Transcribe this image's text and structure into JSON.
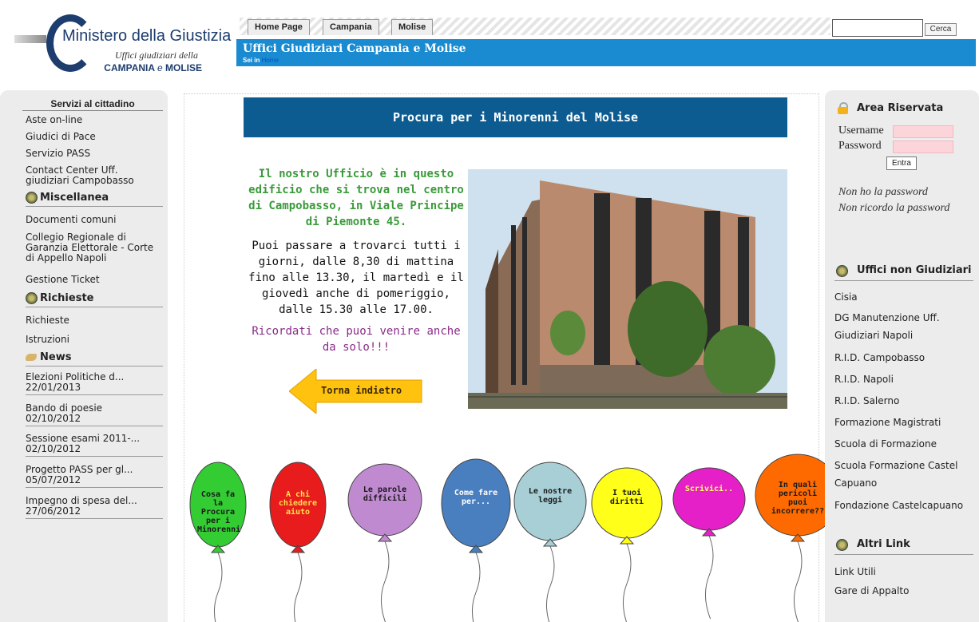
{
  "header": {
    "logo_title_part1": "Ministero della",
    "logo_title_part2": "Giustizia",
    "logo_sub1": "Uffici giudiziari della",
    "logo_sub2_a": "CAMPANIA",
    "logo_sub2_b": "e",
    "logo_sub2_c": "MOLISE",
    "tabs": [
      "Home Page",
      "Campania",
      "Molise"
    ],
    "site_title": "Uffici Giudiziari Campania e Molise",
    "breadcrumb_prefix": "Sei in",
    "breadcrumb_link": "Home",
    "search_button": "Cerca",
    "search_value": ""
  },
  "left_sidebar": {
    "section_title": "Servizi al cittadino",
    "servizi": [
      "Aste on-line",
      "Giudici di Pace",
      "Servizio PASS",
      "Contact Center Uff. giudiziari Campobasso"
    ],
    "misc_title": "Miscellanea",
    "misc": [
      "Documenti comuni",
      "Collegio Regionale di Garanzia Elettorale - Corte di Appello Napoli",
      "Gestione Ticket"
    ],
    "richieste_title": "Richieste",
    "richieste": [
      "Richieste",
      "Istruzioni"
    ],
    "news_title": "News",
    "news": [
      {
        "title": "Elezioni Politiche d...",
        "date": "22/01/2013"
      },
      {
        "title": "Bando di poesie",
        "date": "02/10/2012"
      },
      {
        "title": "Sessione esami 2011-...",
        "date": "02/10/2012"
      },
      {
        "title": "Progetto PASS per gl...",
        "date": "05/07/2012"
      },
      {
        "title": "Impegno di spesa del...",
        "date": "27/06/2012"
      }
    ]
  },
  "main": {
    "banner": "Procura per i Minorenni del Molise",
    "p1": "Il nostro Ufficio è in questo edificio che si trova nel centro di Campobasso, in Viale Principe di Piemonte 45.",
    "p2": "Puoi passare a trovarci tutti i giorni, dalle 8,30 di mattina fino alle 13.30, il martedì e il giovedì anche di pomeriggio, dalle 15.30 alle 17.00.",
    "p3": "Ricordati che puoi venire anche da solo!!!",
    "back_label": "Torna indietro",
    "balloons": [
      {
        "label": "Cosa fa la Procura per i Minorenni",
        "color": "#33cc33",
        "text_color": "#1a1a1a"
      },
      {
        "label": "A chi chiedere aiuto",
        "color": "#e81c1c",
        "text_color": "#ffe14d"
      },
      {
        "label": "Le parole difficili",
        "color": "#c08ad0",
        "text_color": "#1a1a1a"
      },
      {
        "label": "Come fare per...",
        "color": "#4a7fbf",
        "text_color": "#ffffff"
      },
      {
        "label": "Le nostre leggi",
        "color": "#a8cfd6",
        "text_color": "#1a1a1a"
      },
      {
        "label": "I tuoi diritti",
        "color": "#ffff1a",
        "text_color": "#1a1a1a"
      },
      {
        "label": "Scrivici..",
        "color": "#e620c8",
        "text_color": "#ffff66"
      },
      {
        "label": "In quali pericoli puoi incorrere??",
        "color": "#ff6a00",
        "text_color": "#1a1a1a"
      }
    ]
  },
  "right_sidebar": {
    "area_title": "Area Riservata",
    "username_label": "Username",
    "password_label": "Password",
    "login_button": "Entra",
    "no_password": "Non ho la password",
    "forgot_password": "Non ricordo la password",
    "uffici_title": "Uffici non Giudiziari",
    "uffici": [
      "Cisia",
      "DG Manutenzione Uff. Giudiziari Napoli",
      "R.I.D. Campobasso",
      "R.I.D. Napoli",
      "R.I.D. Salerno",
      "Formazione Magistrati",
      "Scuola di Formazione",
      "Scuola Formazione Castel Capuano",
      "Fondazione Castelcapuano"
    ],
    "altri_title": "Altri Link",
    "altri": [
      "Link Utili",
      "Gare di Appalto"
    ]
  }
}
